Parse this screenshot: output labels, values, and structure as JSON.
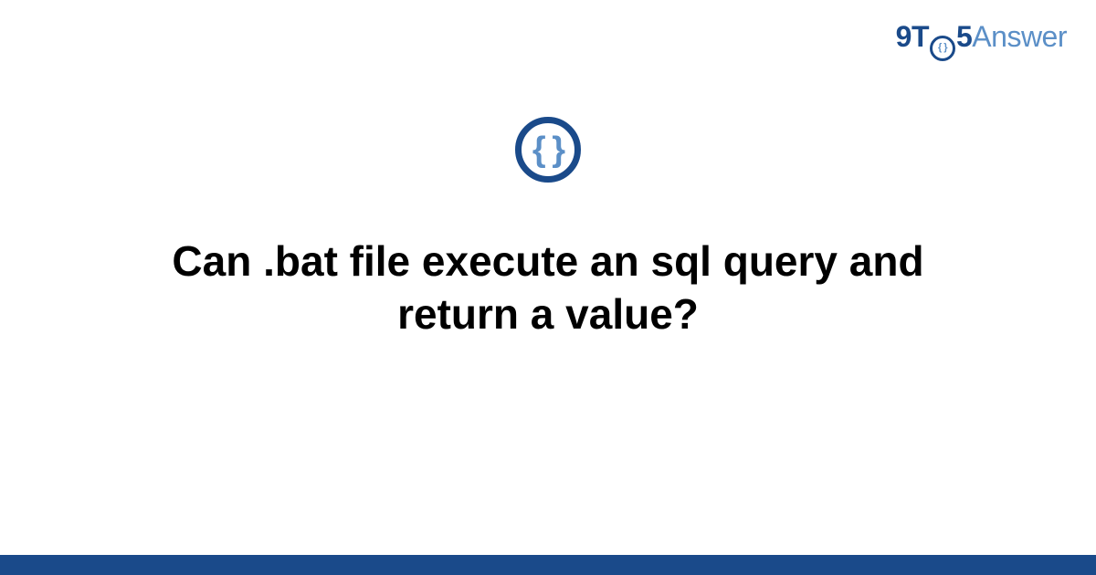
{
  "logo": {
    "part1": "9T",
    "o_inner": "{ }",
    "part2": "5",
    "part3": "Answer"
  },
  "icon": {
    "braces": "{ }"
  },
  "headline": "Can .bat file execute an sql query and return a value?"
}
